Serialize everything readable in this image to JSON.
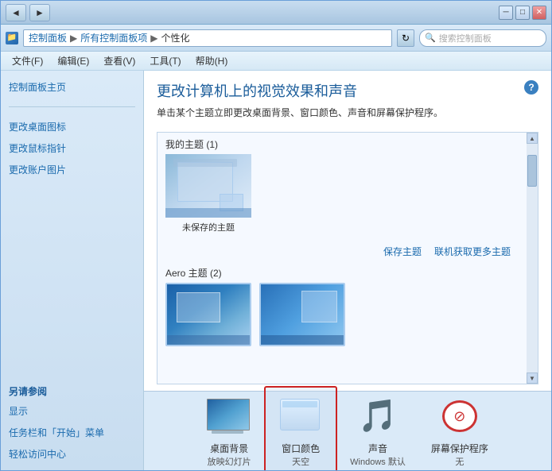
{
  "window": {
    "title": "个性化",
    "minimize_label": "─",
    "maximize_label": "□",
    "close_label": "✕"
  },
  "address": {
    "breadcrumb": {
      "part1": "控制面板",
      "arrow1": "▶",
      "part2": "所有控制面板项",
      "arrow2": "▶",
      "part3": "个性化"
    },
    "search_placeholder": "搜索控制面板"
  },
  "menu": {
    "items": [
      {
        "label": "文件(F)"
      },
      {
        "label": "编辑(E)"
      },
      {
        "label": "查看(V)"
      },
      {
        "label": "工具(T)"
      },
      {
        "label": "帮助(H)"
      }
    ]
  },
  "sidebar": {
    "main_link": "控制面板主页",
    "links": [
      {
        "label": "更改桌面图标"
      },
      {
        "label": "更改鼠标指针"
      },
      {
        "label": "更改账户图片"
      }
    ],
    "also_label": "另请参阅",
    "also_links": [
      {
        "label": "显示"
      },
      {
        "label": "任务栏和「开始」菜单"
      },
      {
        "label": "轻松访问中心"
      }
    ]
  },
  "content": {
    "title": "更改计算机上的视觉效果和声音",
    "description": "单击某个主题立即更改桌面背景、窗口颜色、声音和屏幕保护程序。",
    "my_themes_label": "我的主题 (1)",
    "unsaved_theme_label": "未保存的主题",
    "save_link": "保存主题",
    "more_link": "联机获取更多主题",
    "aero_themes_label": "Aero 主题 (2)"
  },
  "toolbar": {
    "items": [
      {
        "id": "wallpaper",
        "label": "桌面背景",
        "sublabel": "放映幻灯片",
        "selected": false
      },
      {
        "id": "wincolor",
        "label": "窗口颜色",
        "sublabel": "天空",
        "selected": true
      },
      {
        "id": "sound",
        "label": "声音",
        "sublabel": "Windows 默认",
        "selected": false
      },
      {
        "id": "screensaver",
        "label": "屏幕保护程序",
        "sublabel": "无",
        "selected": false
      }
    ]
  },
  "icons": {
    "help": "?",
    "back": "◄",
    "forward": "►",
    "refresh": "↻",
    "search": "🔍",
    "scroll_up": "▲",
    "scroll_down": "▼"
  }
}
